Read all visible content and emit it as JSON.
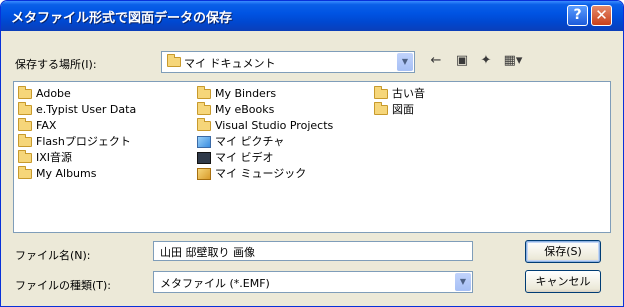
{
  "window": {
    "title": "メタファイル形式で図面データの保存",
    "help_glyph": "?",
    "close_glyph": "✕"
  },
  "save_in": {
    "label": "保存する場所(I):",
    "value": "マイ ドキュメント"
  },
  "toolbar": {
    "back_icon": "←",
    "up_icon": "▣",
    "new_folder_icon": "✦",
    "view_icon": "▦▾"
  },
  "files": [
    {
      "name": "Adobe",
      "icon": "folder-icon"
    },
    {
      "name": "e.Typist User Data",
      "icon": "folder-icon"
    },
    {
      "name": "FAX",
      "icon": "folder-icon"
    },
    {
      "name": "Flashプロジェクト",
      "icon": "folder-icon"
    },
    {
      "name": "IXI音源",
      "icon": "folder-icon"
    },
    {
      "name": "My Albums",
      "icon": "folder-icon"
    },
    {
      "name": "My Binders",
      "icon": "folder-icon"
    },
    {
      "name": "My eBooks",
      "icon": "folder-icon"
    },
    {
      "name": "Visual Studio Projects",
      "icon": "folder-icon"
    },
    {
      "name": "マイ ピクチャ",
      "icon": "pictures-icon"
    },
    {
      "name": "マイ ビデオ",
      "icon": "video-icon"
    },
    {
      "name": "マイ ミュージック",
      "icon": "music-icon"
    },
    {
      "name": "古い音",
      "icon": "folder-icon"
    },
    {
      "name": "図面",
      "icon": "folder-icon"
    }
  ],
  "filename": {
    "label": "ファイル名(N):",
    "value": "山田 邸壁取り 画像"
  },
  "filetype": {
    "label": "ファイルの種類(T):",
    "value": "メタファイル (*.EMF)"
  },
  "buttons": {
    "save": "保存(S)",
    "cancel": "キャンセル"
  },
  "colors": {
    "titlebar": "#0054e3",
    "dialog_bg": "#ece9d8",
    "border": "#7f9db9"
  }
}
